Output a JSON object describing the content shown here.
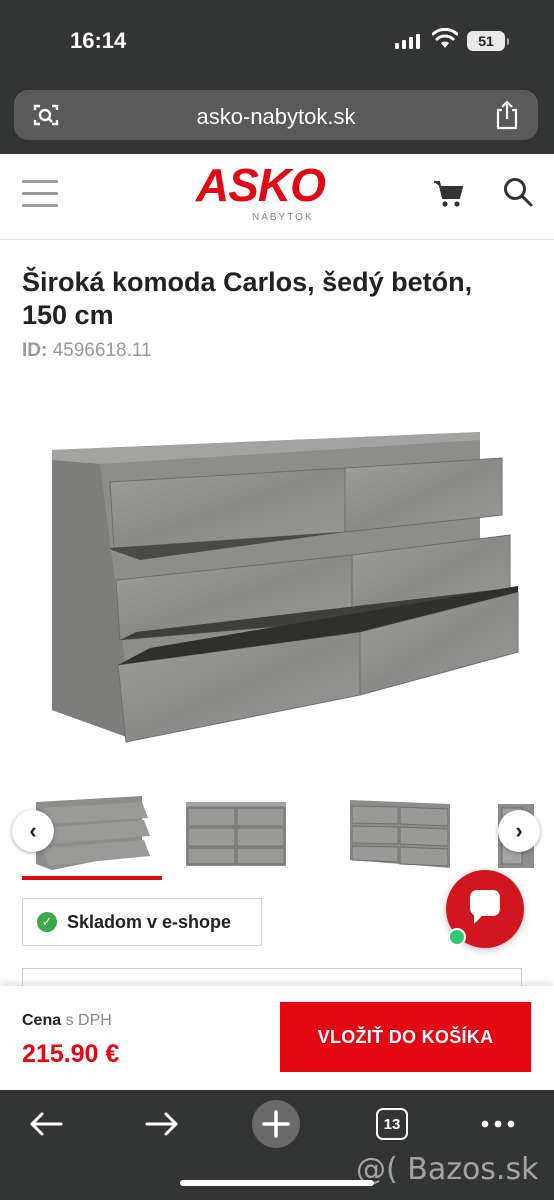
{
  "status": {
    "time": "16:14",
    "battery": "51"
  },
  "browser": {
    "url": "asko-nabytok.sk",
    "tabs_count": "13"
  },
  "site": {
    "logo": "ASKO",
    "logo_sub": "NÁBYTOK"
  },
  "product": {
    "title": "Široká komoda Carlos, šedý betón, 150 cm",
    "id_label": "ID:",
    "id_value": "4596618.11",
    "stock": "Skladom v e-shope"
  },
  "price": {
    "label": "Cena",
    "vat": "s DPH",
    "value": "215.90 €",
    "button": "VLOŽIŤ DO KOŠÍKA"
  },
  "gallery": {
    "prev": "‹",
    "next": "›"
  },
  "watermark": "@( Bazos.sk",
  "colors": {
    "accent": "#e30613",
    "chrome": "#333434",
    "success": "#3aa948"
  }
}
